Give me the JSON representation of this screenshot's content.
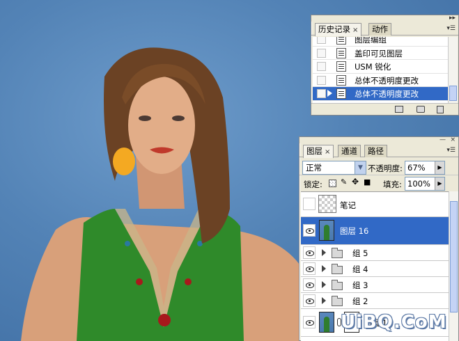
{
  "history_panel": {
    "tabs": [
      {
        "label": "历史记录",
        "active": true,
        "close": "×"
      },
      {
        "label": "动作",
        "active": false
      }
    ],
    "menu_icon": "panel-menu-icon",
    "items": [
      {
        "label": "图层编组",
        "selected": false
      },
      {
        "label": "盖印可见图层",
        "selected": false
      },
      {
        "label": "USM 锐化",
        "selected": false
      },
      {
        "label": "总体不透明度更改",
        "selected": false
      },
      {
        "label": "总体不透明度更改",
        "selected": true
      }
    ],
    "footer_icons": [
      "new-document-from-state-icon",
      "camera-snapshot-icon",
      "trash-icon"
    ]
  },
  "layers_panel": {
    "tabs": [
      {
        "label": "图层",
        "active": true,
        "close": "×"
      },
      {
        "label": "通道",
        "active": false
      },
      {
        "label": "路径",
        "active": false
      }
    ],
    "blend_mode": "正常",
    "opacity_label": "不透明度:",
    "opacity_value": "67%",
    "lock_label": "锁定:",
    "fill_label": "填充:",
    "fill_value": "100%",
    "layers": [
      {
        "name": "笔记",
        "visible": false,
        "type": "normal",
        "thumb": "checker",
        "selected": false
      },
      {
        "name": "图层 16",
        "visible": true,
        "type": "normal",
        "thumb": "photo",
        "selected": true
      },
      {
        "name": "组 5",
        "visible": true,
        "type": "group",
        "selected": false
      },
      {
        "name": "组 4",
        "visible": true,
        "type": "group",
        "selected": false
      },
      {
        "name": "组 3",
        "visible": true,
        "type": "group",
        "selected": false
      },
      {
        "name": "组 2",
        "visible": true,
        "type": "group",
        "selected": false
      },
      {
        "name": "图层 10",
        "visible": true,
        "type": "masked",
        "thumb": "photo",
        "selected": false
      }
    ]
  },
  "watermark": "UiBQ.CoM",
  "colors": {
    "selection": "#3169c6",
    "panel_bg": "#ece9d8",
    "backdrop_blue": "#5383b6",
    "dress_green": "#2f8a2a"
  }
}
